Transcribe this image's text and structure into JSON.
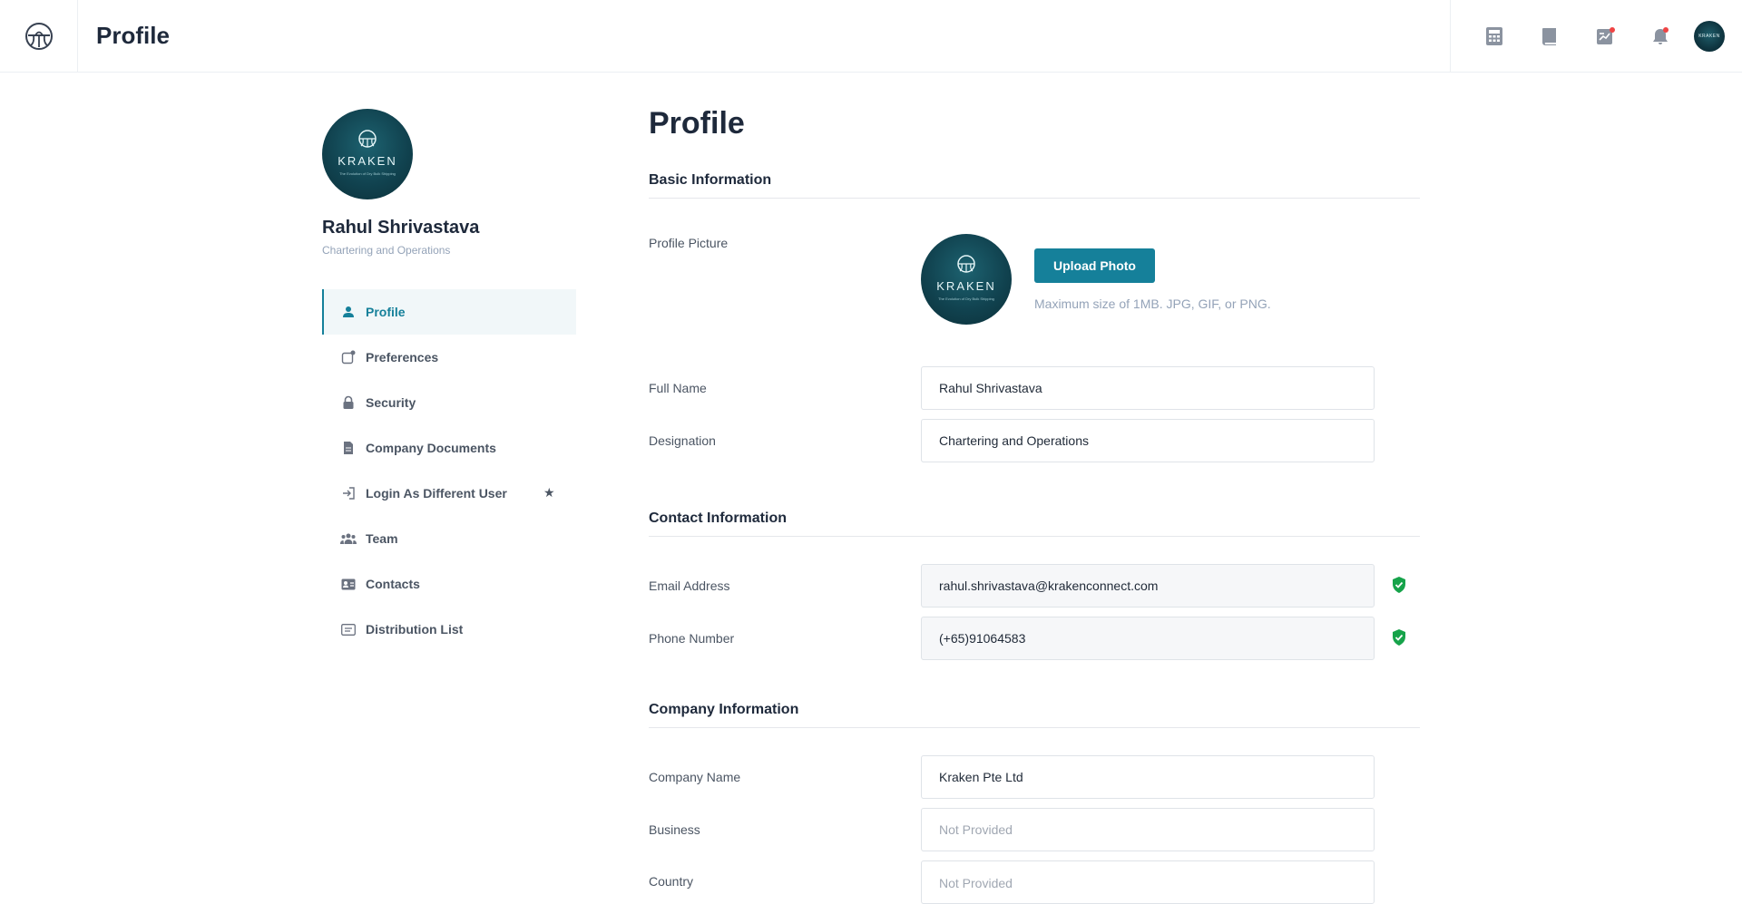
{
  "header": {
    "title": "Profile",
    "avatar_text": "KRAKEN"
  },
  "sidebar": {
    "name": "Rahul Shrivastava",
    "role": "Chartering and Operations",
    "brand_word": "KRAKEN",
    "brand_tagline": "The Evolution of Dry Bulk Shipping",
    "items": [
      {
        "label": "Profile",
        "icon": "person-icon",
        "active": true
      },
      {
        "label": "Preferences",
        "icon": "preferences-icon"
      },
      {
        "label": "Security",
        "icon": "lock-icon"
      },
      {
        "label": "Company Documents",
        "icon": "document-icon"
      },
      {
        "label": "Login As Different User",
        "icon": "login-icon",
        "badge": "★"
      },
      {
        "label": "Team",
        "icon": "team-icon"
      },
      {
        "label": "Contacts",
        "icon": "contact-card-icon"
      },
      {
        "label": "Distribution List",
        "icon": "list-icon"
      }
    ]
  },
  "main": {
    "title": "Profile",
    "basic": {
      "heading": "Basic Information",
      "picture_label": "Profile Picture",
      "upload_label": "Upload Photo",
      "upload_hint": "Maximum size of 1MB. JPG, GIF, or PNG.",
      "full_name_label": "Full Name",
      "full_name": "Rahul Shrivastava",
      "designation_label": "Designation",
      "designation": "Chartering and Operations"
    },
    "contact": {
      "heading": "Contact Information",
      "email_label": "Email Address",
      "email": "rahul.shrivastava@krakenconnect.com",
      "phone_label": "Phone Number",
      "phone": "(+65)91064583"
    },
    "company": {
      "heading": "Company Information",
      "company_name_label": "Company Name",
      "company_name": "Kraken Pte Ltd",
      "business_label": "Business",
      "business_placeholder": "Not Provided",
      "country_label": "Country",
      "country_placeholder": "Not Provided"
    }
  },
  "colors": {
    "accent": "#15809a",
    "verified": "#16a34a",
    "notification_dot": "#ef4444"
  }
}
